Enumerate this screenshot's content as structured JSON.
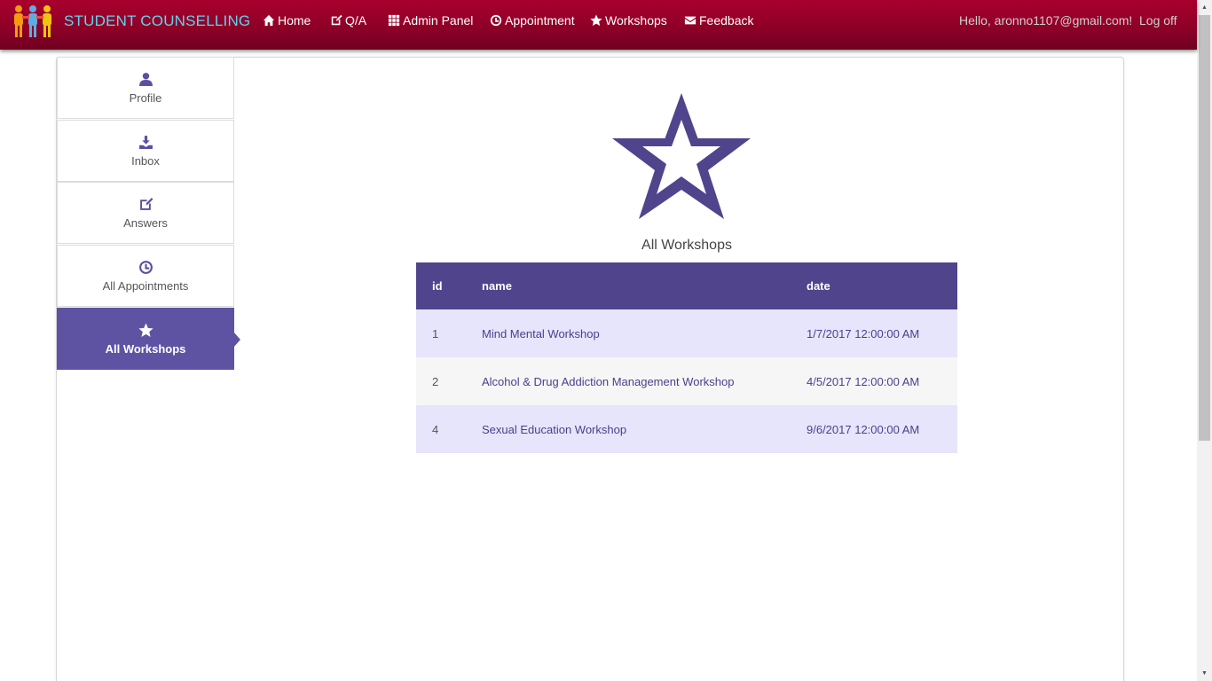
{
  "brand": {
    "title": "STUDENT COUNSELLING"
  },
  "nav": {
    "items": [
      {
        "label": "Home",
        "icon": "home-icon"
      },
      {
        "label": "Q/A",
        "icon": "edit-icon"
      },
      {
        "label": "Admin Panel",
        "icon": "grid-icon"
      },
      {
        "label": "Appointment",
        "icon": "clock-icon"
      },
      {
        "label": "Workshops",
        "icon": "star-icon"
      },
      {
        "label": "Feedback",
        "icon": "envelope-icon"
      }
    ],
    "greeting": "Hello, aronno1107@gmail.com!",
    "logoff": "Log off"
  },
  "sidebar": {
    "items": [
      {
        "label": "Profile",
        "icon": "user-icon"
      },
      {
        "label": "Inbox",
        "icon": "download-icon"
      },
      {
        "label": "Answers",
        "icon": "edit-icon"
      },
      {
        "label": "All Appointments",
        "icon": "clock-icon"
      },
      {
        "label": "All Workshops",
        "icon": "star-icon",
        "active": true
      }
    ]
  },
  "main": {
    "title": "All Workshops",
    "table": {
      "headers": [
        "id",
        "name",
        "date"
      ],
      "rows": [
        {
          "id": "1",
          "name": "Mind Mental Workshop",
          "date": "1/7/2017 12:00:00 AM"
        },
        {
          "id": "2",
          "name": "Alcohol & Drug Addiction Management Workshop",
          "date": "4/5/2017 12:00:00 AM"
        },
        {
          "id": "4",
          "name": "Sexual Education Workshop",
          "date": "9/6/2017 12:00:00 AM"
        }
      ]
    }
  },
  "colors": {
    "navbar": "#8c0026",
    "brand_text": "#5fd4f0",
    "accent": "#5e53a3",
    "table_header": "#50448d",
    "row_odd": "#e6e5fb",
    "row_even": "#f6f6f6"
  }
}
